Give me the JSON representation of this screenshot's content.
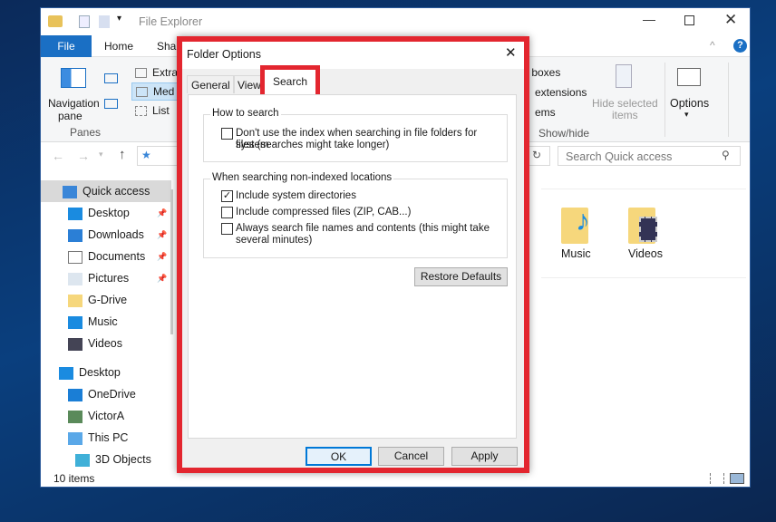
{
  "explorer": {
    "title": "File Explorer",
    "ribbon_tabs": [
      "File",
      "Home",
      "Sha"
    ],
    "ribbon": {
      "navigation_pane": "Navigation",
      "navigation_pane2": "pane",
      "panes_group": "Panes",
      "layout_items": [
        "Extra",
        "Med",
        "List"
      ],
      "checkboxes": [
        "k boxes",
        "extensions",
        "ems"
      ],
      "hide_selected": "Hide selected",
      "hide_selected2": "items",
      "show_hide_group": "Show/hide",
      "options": "Options"
    },
    "search_placeholder": "Search Quick access",
    "nav": [
      {
        "label": "Quick access",
        "icon": "star-icon"
      },
      {
        "label": "Desktop",
        "icon": "desktop-icon",
        "pinned": true
      },
      {
        "label": "Downloads",
        "icon": "download-icon",
        "pinned": true
      },
      {
        "label": "Documents",
        "icon": "document-icon",
        "pinned": true
      },
      {
        "label": "Pictures",
        "icon": "pictures-icon",
        "pinned": true
      },
      {
        "label": "G-Drive",
        "icon": "drive-icon"
      },
      {
        "label": "Music",
        "icon": "music-icon"
      },
      {
        "label": "Videos",
        "icon": "video-icon"
      },
      {
        "label": "Desktop",
        "icon": "desktop-icon"
      },
      {
        "label": "OneDrive",
        "icon": "cloud-icon"
      },
      {
        "label": "VictorA",
        "icon": "user-icon"
      },
      {
        "label": "This PC",
        "icon": "computer-icon"
      },
      {
        "label": "3D Objects",
        "icon": "cube-icon"
      }
    ],
    "folders": [
      {
        "label": "Music",
        "icon": "music-folder-icon"
      },
      {
        "label": "Videos",
        "icon": "video-folder-icon"
      }
    ],
    "status": "10 items"
  },
  "dialog": {
    "title": "Folder Options",
    "tabs": [
      "General",
      "View",
      "Search"
    ],
    "active_tab": "Search",
    "how_to_search": "How to search",
    "dont_use_index": "Don't use the index when searching in file folders for system",
    "dont_use_index2": "files (searches might take longer)",
    "dont_use_index_checked": false,
    "non_indexed": "When searching non-indexed locations",
    "options": [
      {
        "label": "Include system directories",
        "checked": true
      },
      {
        "label": "Include compressed files (ZIP, CAB...)",
        "checked": false
      },
      {
        "label": "Always search file names and contents (this might take",
        "label2": "several minutes)",
        "checked": false
      }
    ],
    "restore_defaults": "Restore Defaults",
    "ok": "OK",
    "cancel": "Cancel",
    "apply": "Apply"
  },
  "colors": {
    "highlight": "#e3262f",
    "file_tab": "#1a6fc4",
    "desktop": "#0a3f7e"
  }
}
